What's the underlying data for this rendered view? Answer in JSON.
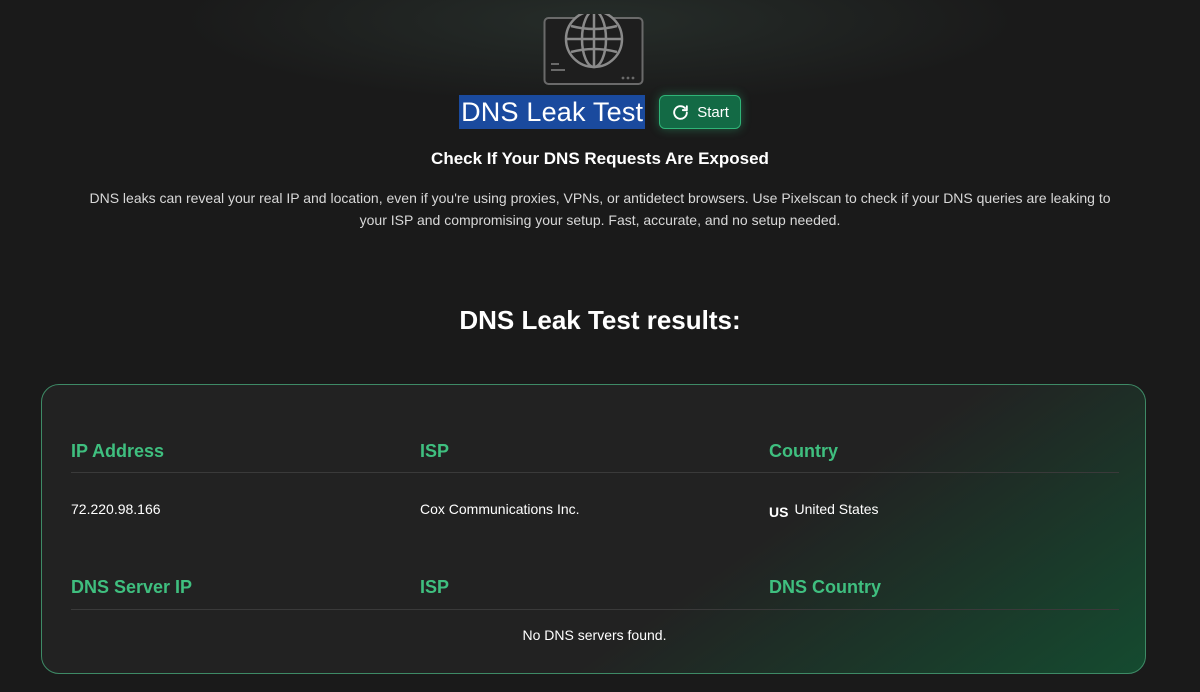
{
  "header": {
    "title": "DNS Leak Test",
    "start_label": "Start",
    "subtitle": "Check If Your DNS Requests Are Exposed",
    "description_line1": "DNS leaks can reveal your real IP and location, even if you're using proxies, VPNs, or antidetect browsers. Use Pixelscan to check if your DNS queries are leaking to",
    "description_line2": "your ISP and compromising your setup. Fast, accurate, and no setup needed."
  },
  "results": {
    "title": "DNS Leak Test results:",
    "connection": {
      "headers": [
        "IP Address",
        "ISP",
        "Country"
      ],
      "ip": "72.220.98.166",
      "isp": "Cox Communications Inc.",
      "country_code": "US",
      "country": "United States"
    },
    "dns": {
      "headers": [
        "DNS Server IP",
        "ISP",
        "DNS Country"
      ],
      "empty_message": "No DNS servers found."
    }
  },
  "colors": {
    "accent": "#3fbf7f",
    "button_bg": "#136a45",
    "selection": "#1a4a9e",
    "background": "#1a1a1a"
  },
  "icons": {
    "hero": "globe-monitor-icon",
    "start": "refresh-icon"
  }
}
